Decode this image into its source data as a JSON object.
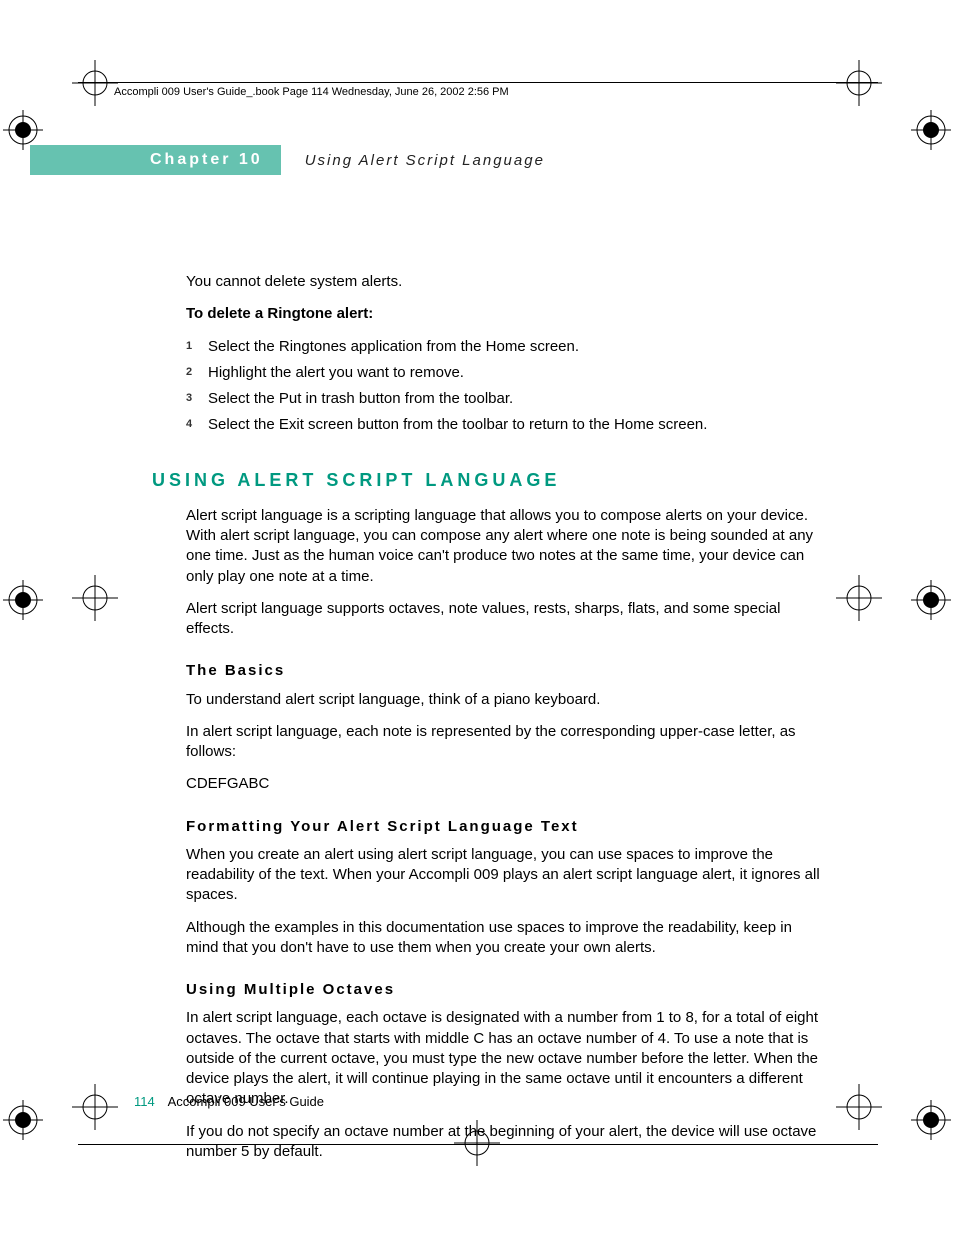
{
  "print_header": "Accompli 009 User's Guide_.book  Page 114  Wednesday, June 26, 2002  2:56 PM",
  "chapter": {
    "label": "Chapter 10",
    "title": "Using Alert Script Language"
  },
  "intro_para": "You cannot delete system alerts.",
  "delete_heading": "To delete a Ringtone alert:",
  "delete_steps": [
    "Select the Ringtones application from the Home screen.",
    "Highlight the alert you want to remove.",
    "Select the Put in trash button from the toolbar.",
    "Select the Exit screen button from the toolbar to return to the Home screen."
  ],
  "section": {
    "heading": "USING ALERT SCRIPT LANGUAGE",
    "p1": "Alert script language is a scripting language that allows you to compose alerts on your device. With alert script language, you can compose any alert where one note is being sounded at any one time. Just as the human voice can't produce two notes at the same time, your device can only play one note at a time.",
    "p2": "Alert script language supports octaves, note values, rests, sharps, flats, and some special effects."
  },
  "basics": {
    "heading": "The Basics",
    "p1": "To understand alert script language, think of a piano keyboard.",
    "p2": "In alert script language, each note is represented by the corresponding upper-case letter, as follows:",
    "p3": "CDEFGABC"
  },
  "formatting": {
    "heading": "Formatting Your Alert Script Language Text",
    "p1": "When you create an alert using alert script language, you can use spaces to improve the readability of the text. When your Accompli 009 plays an alert script language alert, it ignores all spaces.",
    "p2": "Although the examples in this documentation use spaces to improve the readability, keep in mind that you don't have to use them when you create your own alerts."
  },
  "octaves": {
    "heading": "Using Multiple Octaves",
    "p1": "In alert script language, each octave is designated with a number from 1 to 8, for a total of eight octaves. The octave that starts with middle C has an octave number of 4. To use a note that is outside of the current octave, you must type the new octave number before the letter. When the device plays the alert, it will continue playing in the same octave until it encounters a different octave number.",
    "p2": "If you do not specify an octave number at the beginning of your alert, the device will use octave number 5 by default."
  },
  "footer": {
    "page": "114",
    "title": "Accompli 009 User's Guide"
  }
}
